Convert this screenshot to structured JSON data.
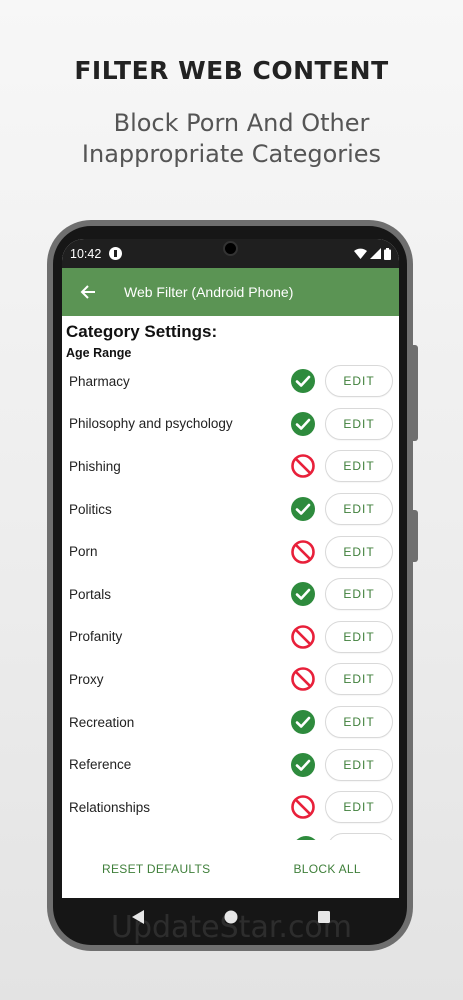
{
  "promo": {
    "headline": "FILTER WEB CONTENT",
    "subline_1": "Block Porn And Other",
    "subline_2": "Inappropriate Categories"
  },
  "status_bar": {
    "time": "10:42"
  },
  "app_bar": {
    "title": "Web Filter (Android Phone)"
  },
  "content": {
    "title": "Category Settings:",
    "subtitle": "Age Range"
  },
  "categories": [
    {
      "name": "Pharmacy",
      "status": "allowed",
      "edit_label": "EDIT"
    },
    {
      "name": "Philosophy and psychology",
      "status": "allowed",
      "edit_label": "EDIT"
    },
    {
      "name": "Phishing",
      "status": "blocked",
      "edit_label": "EDIT"
    },
    {
      "name": "Politics",
      "status": "allowed",
      "edit_label": "EDIT"
    },
    {
      "name": "Porn",
      "status": "blocked",
      "edit_label": "EDIT"
    },
    {
      "name": "Portals",
      "status": "allowed",
      "edit_label": "EDIT"
    },
    {
      "name": "Profanity",
      "status": "blocked",
      "edit_label": "EDIT"
    },
    {
      "name": "Proxy",
      "status": "blocked",
      "edit_label": "EDIT"
    },
    {
      "name": "Recreation",
      "status": "allowed",
      "edit_label": "EDIT"
    },
    {
      "name": "Reference",
      "status": "allowed",
      "edit_label": "EDIT"
    },
    {
      "name": "Relationships",
      "status": "blocked",
      "edit_label": "EDIT"
    }
  ],
  "bottom_actions": {
    "reset_label": "RESET DEFAULTS",
    "block_all_label": "BLOCK ALL"
  },
  "watermark": "UpdateStar.com",
  "colors": {
    "app_bar": "#5b9454",
    "allowed": "#2e8b3d",
    "blocked": "#e8203a",
    "action_text": "#3f7f3a"
  }
}
